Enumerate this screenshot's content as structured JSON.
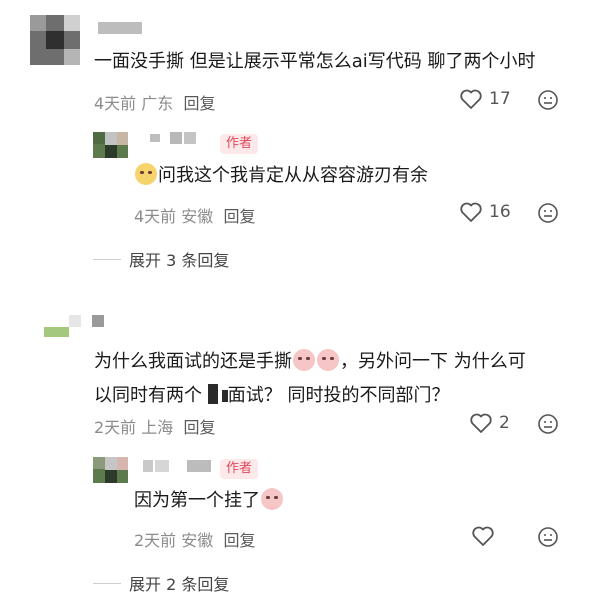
{
  "comments": [
    {
      "text": "一面没手撕 但是让展示平常怎么ai写代码 聊了两个小时",
      "time": "4天前",
      "location": "广东",
      "reply_label": "回复",
      "likes": "17",
      "reply": {
        "author_badge": "作者",
        "text": "问我这个我肯定从从容容游刃有余",
        "time": "4天前",
        "location": "安徽",
        "reply_label": "回复",
        "likes": "16"
      },
      "expand_label": "展开 3 条回复"
    },
    {
      "text_line1_a": "为什么我面试的还是手撕",
      "text_line1_b": "，另外问一下 为什么可",
      "text_line2_a": "以同时有两个",
      "text_line2_b": "面试？ 同时投的不同部门？",
      "time": "2天前",
      "location": "上海",
      "reply_label": "回复",
      "likes": "2",
      "reply": {
        "author_badge": "作者",
        "text": "因为第一个挂了",
        "time": "2天前",
        "location": "安徽",
        "reply_label": "回复"
      },
      "expand_label": "展开 2 条回复"
    }
  ],
  "icons": {
    "like": "heart-outline-icon",
    "emoji": "emoji-reaction-icon"
  }
}
